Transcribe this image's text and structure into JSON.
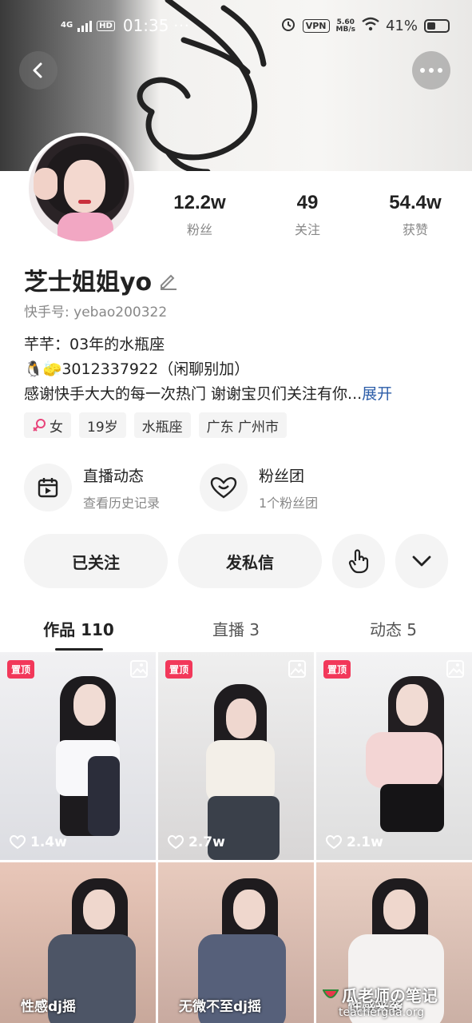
{
  "status_bar": {
    "network": "4G",
    "hd": "HD",
    "time": "01:35",
    "dots": "···",
    "vpn": "VPN",
    "speed_value": "5.60",
    "speed_unit": "MB/s",
    "battery": "41%"
  },
  "header": {
    "back_icon": "chevron-left-icon",
    "more_icon": "more-dots-icon"
  },
  "stats": [
    {
      "value": "12.2w",
      "label": "粉丝"
    },
    {
      "value": "49",
      "label": "关注"
    },
    {
      "value": "54.4w",
      "label": "获赞"
    }
  ],
  "profile": {
    "name": "芝士姐姐yo",
    "kuaishou_id": "快手号: yebao200322",
    "bio_line1": "芊芊：03年的水瓶座",
    "bio_line2": "🐧🧽3012337922（闲聊别加）",
    "bio_line3": "感谢快手大大的每一次热门 谢谢宝贝们关注有你...",
    "bio_expand": "展开"
  },
  "tags": [
    "女",
    "19岁",
    "水瓶座",
    "广东 广州市"
  ],
  "quick_links": [
    {
      "title": "直播动态",
      "subtitle": "查看历史记录",
      "icon": "calendar-play-icon"
    },
    {
      "title": "粉丝团",
      "subtitle": "1个粉丝团",
      "icon": "heart-badge-icon"
    }
  ],
  "actions": {
    "follow": "已关注",
    "message": "发私信",
    "touch_icon": "tap-hand-icon",
    "dropdown_icon": "chevron-down-icon"
  },
  "tabs": [
    {
      "label": "作品 110",
      "active": true
    },
    {
      "label": "直播 3",
      "active": false
    },
    {
      "label": "动态 5",
      "active": false
    }
  ],
  "works": [
    {
      "pinned": "置顶",
      "likes": "1.4w"
    },
    {
      "pinned": "置顶",
      "likes": "2.7w"
    },
    {
      "pinned": "置顶",
      "likes": "2.1w"
    },
    {
      "caption": "性感dj摇"
    },
    {
      "caption": "无微不至dj摇"
    },
    {
      "caption": "性感来袭"
    }
  ],
  "watermark": {
    "line1": "瓜老师の笔记",
    "line2": "teachergua.org"
  },
  "colors": {
    "pin_badge": "#f2385a",
    "expand_link": "#2b5ca8",
    "pill_bg": "#f4f4f4"
  }
}
